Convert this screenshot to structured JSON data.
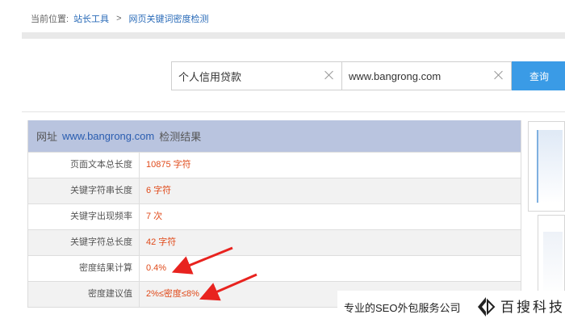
{
  "breadcrumb": {
    "prefix": "当前位置:",
    "items": [
      "站长工具",
      "网页关键词密度检测"
    ],
    "separator": ">"
  },
  "search": {
    "keyword_value": "个人信用贷款",
    "url_value": "www.bangrong.com",
    "query_label": "查询"
  },
  "result": {
    "header_prefix": "网址",
    "header_url": "www.bangrong.com",
    "header_suffix": "检测结果",
    "rows": [
      {
        "label": "页面文本总长度",
        "value": "10875 字符"
      },
      {
        "label": "关键字符串长度",
        "value": "6 字符"
      },
      {
        "label": "关键字出现频率",
        "value": "7 次"
      },
      {
        "label": "关键字符总长度",
        "value": "42 字符"
      },
      {
        "label": "密度结果计算",
        "value": "0.4%"
      },
      {
        "label": "密度建议值",
        "value": "2%≤密度≤8%"
      }
    ]
  },
  "watermark": {
    "slogan": "专业的SEO外包服务公司",
    "brand": "百搜科技"
  },
  "colors": {
    "accent_blue": "#3a9be6",
    "value_red": "#e04a1a",
    "header_bg": "#b9c4df",
    "arrow_red": "#e8231f"
  }
}
